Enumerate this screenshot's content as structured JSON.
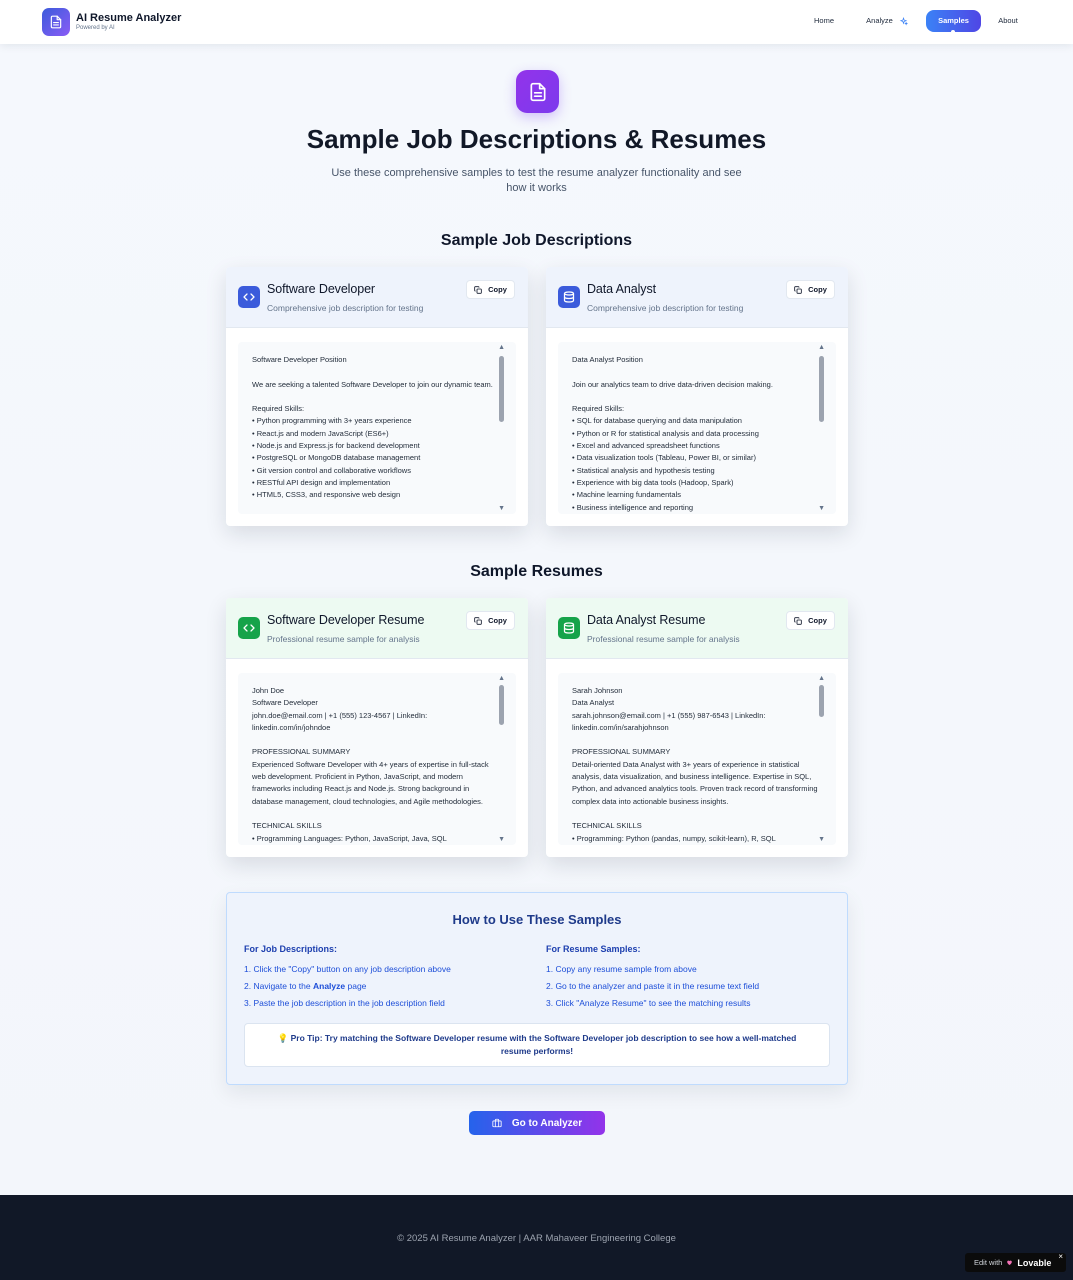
{
  "nav": {
    "brand": "AI Resume Analyzer",
    "brand_sub": "Powered by AI",
    "links": {
      "home": "Home",
      "analyze": "Analyze",
      "samples": "Samples",
      "about": "About"
    }
  },
  "hero": {
    "title": "Sample Job Descriptions & Resumes",
    "subtitle": "Use these comprehensive samples to test the resume analyzer functionality and see how it works"
  },
  "sections": {
    "jobs_title": "Sample Job Descriptions",
    "resumes_title": "Sample Resumes"
  },
  "copy_label": "Copy",
  "cards": {
    "job_dev": {
      "title": "Software Developer",
      "subtitle": "Comprehensive job description for testing",
      "text": "Software Developer Position\n\nWe are seeking a talented Software Developer to join our dynamic team.\n\nRequired Skills:\n• Python programming with 3+ years experience\n• React.js and modern JavaScript (ES6+)\n• Node.js and Express.js for backend development\n• PostgreSQL or MongoDB database management\n• Git version control and collaborative workflows\n• RESTful API design and implementation\n• HTML5, CSS3, and responsive web design"
    },
    "job_data": {
      "title": "Data Analyst",
      "subtitle": "Comprehensive job description for testing",
      "text": "Data Analyst Position\n\nJoin our analytics team to drive data-driven decision making.\n\nRequired Skills:\n• SQL for database querying and data manipulation\n• Python or R for statistical analysis and data processing\n• Excel and advanced spreadsheet functions\n• Data visualization tools (Tableau, Power BI, or similar)\n• Statistical analysis and hypothesis testing\n• Experience with big data tools (Hadoop, Spark)\n• Machine learning fundamentals\n• Business intelligence and reporting"
    },
    "resume_dev": {
      "title": "Software Developer Resume",
      "subtitle": "Professional resume sample for analysis",
      "text": "John Doe\nSoftware Developer\njohn.doe@email.com | +1 (555) 123-4567 | LinkedIn: linkedin.com/in/johndoe\n\nPROFESSIONAL SUMMARY\nExperienced Software Developer with 4+ years of expertise in full-stack web development. Proficient in Python, JavaScript, and modern frameworks including React.js and Node.js. Strong background in database management, cloud technologies, and Agile methodologies.\n\nTECHNICAL SKILLS\n• Programming Languages: Python, JavaScript, Java, SQL"
    },
    "resume_data": {
      "title": "Data Analyst Resume",
      "subtitle": "Professional resume sample for analysis",
      "text": "Sarah Johnson\nData Analyst\nsarah.johnson@email.com | +1 (555) 987-6543 | LinkedIn: linkedin.com/in/sarahjohnson\n\nPROFESSIONAL SUMMARY\nDetail-oriented Data Analyst with 3+ years of experience in statistical analysis, data visualization, and business intelligence. Expertise in SQL, Python, and advanced analytics tools. Proven track record of transforming complex data into actionable business insights.\n\nTECHNICAL SKILLS\n• Programming: Python (pandas, numpy, scikit-learn), R, SQL"
    }
  },
  "howto": {
    "title": "How to Use These Samples",
    "jobs_title": "For Job Descriptions:",
    "jobs_1": "1. Click the \"Copy\" button on any job description above",
    "jobs_2_pre": "2. Navigate to the ",
    "jobs_2_bold": "Analyze",
    "jobs_2_post": " page",
    "jobs_3": "3. Paste the job description in the job description field",
    "resumes_title": "For Resume Samples:",
    "resumes_1": "1. Copy any resume sample from above",
    "resumes_2": "2. Go to the analyzer and paste it in the resume text field",
    "resumes_3": "3. Click \"Analyze Resume\" to see the matching results",
    "tip": "💡 Pro Tip: Try matching the Software Developer resume with the Software Developer job description to see how a well-matched resume performs!"
  },
  "cta": {
    "label": "Go to Analyzer"
  },
  "footer": {
    "text": "© 2025 AI Resume Analyzer | AAR Mahaveer Engineering College"
  },
  "badge": {
    "pre": "Edit with",
    "brand": "Lovable",
    "close": "×"
  },
  "colors": {
    "accent_blue": "#3b5bdb",
    "accent_purple": "#7c3aed",
    "accent_green": "#16a34a",
    "footer_bg": "#111827"
  },
  "icons": [
    "file-text-icon",
    "sparkle-icon",
    "code-icon",
    "database-icon",
    "copy-icon",
    "briefcase-icon",
    "lovable-heart-icon"
  ]
}
